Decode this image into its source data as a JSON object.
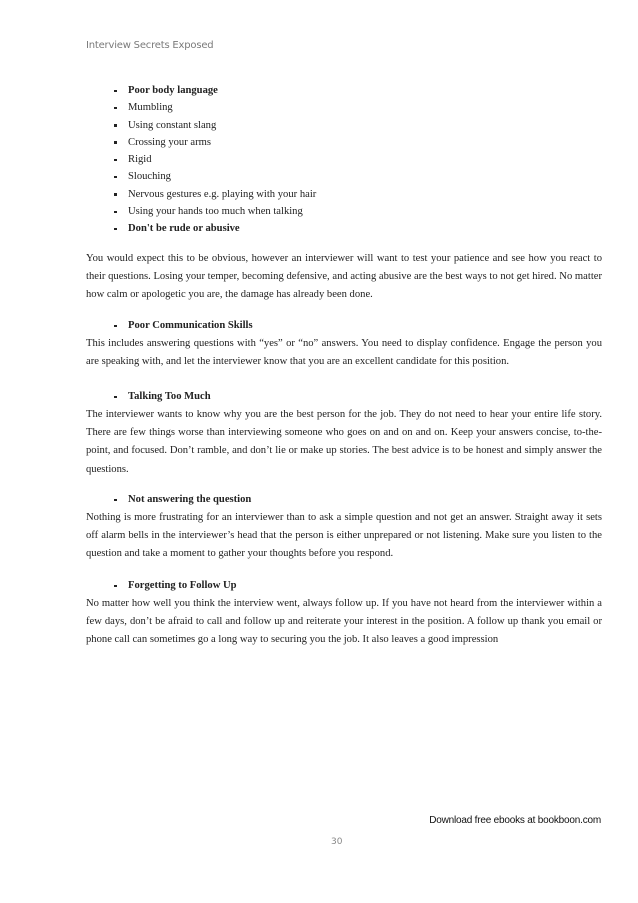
{
  "header": {
    "running_title": "Interview Secrets Exposed"
  },
  "bullet_list": [
    {
      "text": "Poor body language",
      "bold": true
    },
    {
      "text": "Mumbling",
      "bold": false
    },
    {
      "text": "Using constant slang",
      "bold": false
    },
    {
      "text": "Crossing your arms",
      "bold": false
    },
    {
      "text": "Rigid",
      "bold": false
    },
    {
      "text": "Slouching",
      "bold": false
    },
    {
      "text": "Nervous gestures e.g. playing with your hair",
      "bold": false
    },
    {
      "text": "Using your hands too much when talking",
      "bold": false
    },
    {
      "text": "Don't be rude or abusive",
      "bold": true
    }
  ],
  "intro_paragraph": "You would expect this to be obvious, however an interviewer will want to test your patience and see how you react to their questions. Losing your temper, becoming defensive, and acting abusive are the best ways to not get hired. No matter how calm or apologetic you are, the damage has already been done.",
  "sections": [
    {
      "heading": "Poor Communication Skills",
      "body": "This includes answering questions with “yes” or “no” answers. You need to display confidence. Engage the person you are speaking with, and let the interviewer know that you are an excellent candidate for this position."
    },
    {
      "heading": "Talking Too Much",
      "body": "The interviewer wants to know why you are the best person for the job. They do not need to hear your entire life story. There are few things worse than interviewing someone who goes on and on and on.  Keep your answers concise, to-the-point, and focused. Don’t ramble, and don’t lie or make up stories. The best advice is to be honest and simply answer the questions."
    },
    {
      "heading": "Not answering the question",
      "body": "Nothing is more frustrating for an interviewer than to ask a simple question and not get an answer. Straight away it sets off alarm bells in the interviewer’s head that the person is either unprepared or not listening. Make sure you listen to the question and take a moment to gather your thoughts before you respond."
    },
    {
      "heading": "Forgetting to Follow Up",
      "body": "No matter how well you think the interview went, always follow up. If you have not heard from the interviewer within a few days, don’t be afraid to call and follow up and reiterate your interest in the position. A follow up thank you email or phone call can sometimes go a long way to securing you the job. It also leaves a good impression"
    }
  ],
  "footer": {
    "download_link": "Download free ebooks at bookboon.com",
    "page_number": "30"
  }
}
